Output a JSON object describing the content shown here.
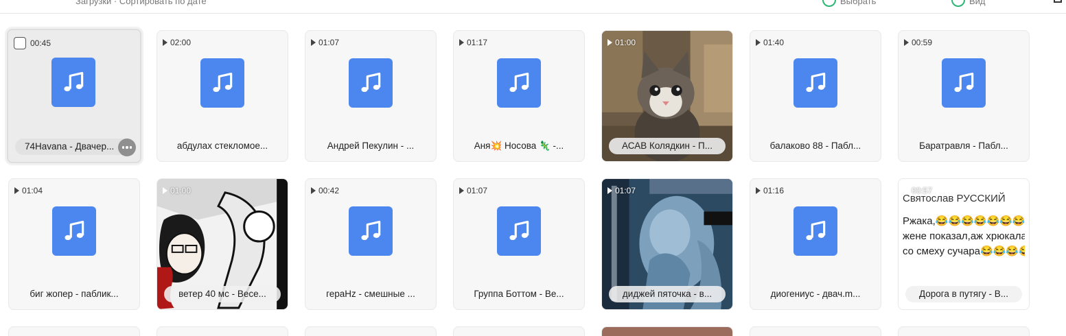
{
  "topbar": {
    "left_text": "Загрузки · Сортировать по дате",
    "right_text_1": "Выбрать",
    "right_text_2": "Вид"
  },
  "items": [
    {
      "duration": "00:45",
      "title": "74Havana - Двачер...",
      "selected": true
    },
    {
      "duration": "02:00",
      "title": "абдулах стекломое..."
    },
    {
      "duration": "01:07",
      "title": "Андрей Пекулин - ..."
    },
    {
      "duration": "01:17",
      "title": "Аня💥 Носова 🦎 -..."
    },
    {
      "duration": "01:00",
      "title": "АСАВ Колядкин - П...",
      "thumbnail": "cat-photo"
    },
    {
      "duration": "01:40",
      "title": "балаково 88 - Пабл..."
    },
    {
      "duration": "00:59",
      "title": "Баратравля - Пабл..."
    },
    {
      "duration": "01:04",
      "title": "биг жопер - паблик..."
    },
    {
      "duration": "01:00",
      "title": "ветер 40 мс - Весе...",
      "thumbnail": "manga-art"
    },
    {
      "duration": "00:42",
      "title": "гераHz - смешные ..."
    },
    {
      "duration": "01:07",
      "title": "Группа Боттом - Ве..."
    },
    {
      "duration": "01:07",
      "title": "диджей пяточка - в...",
      "thumbnail": "blue-photo"
    },
    {
      "duration": "01:16",
      "title": "диогениус - двач.m..."
    },
    {
      "duration": "00:57",
      "title": "Дорога в путягу - В...",
      "thumbnail": "text-meme",
      "thumb_text": [
        "Святослав РУССКИЙ",
        "Ржака,😂😂😂😂😂😂😂😂",
        "жене показал,аж хрюкала",
        "со смеху сучара😂😂😂😂"
      ]
    }
  ],
  "icons": {
    "play": "play-icon",
    "music": "music-note-icon",
    "more": "more-dots-icon",
    "checkbox": "checkbox-icon"
  }
}
